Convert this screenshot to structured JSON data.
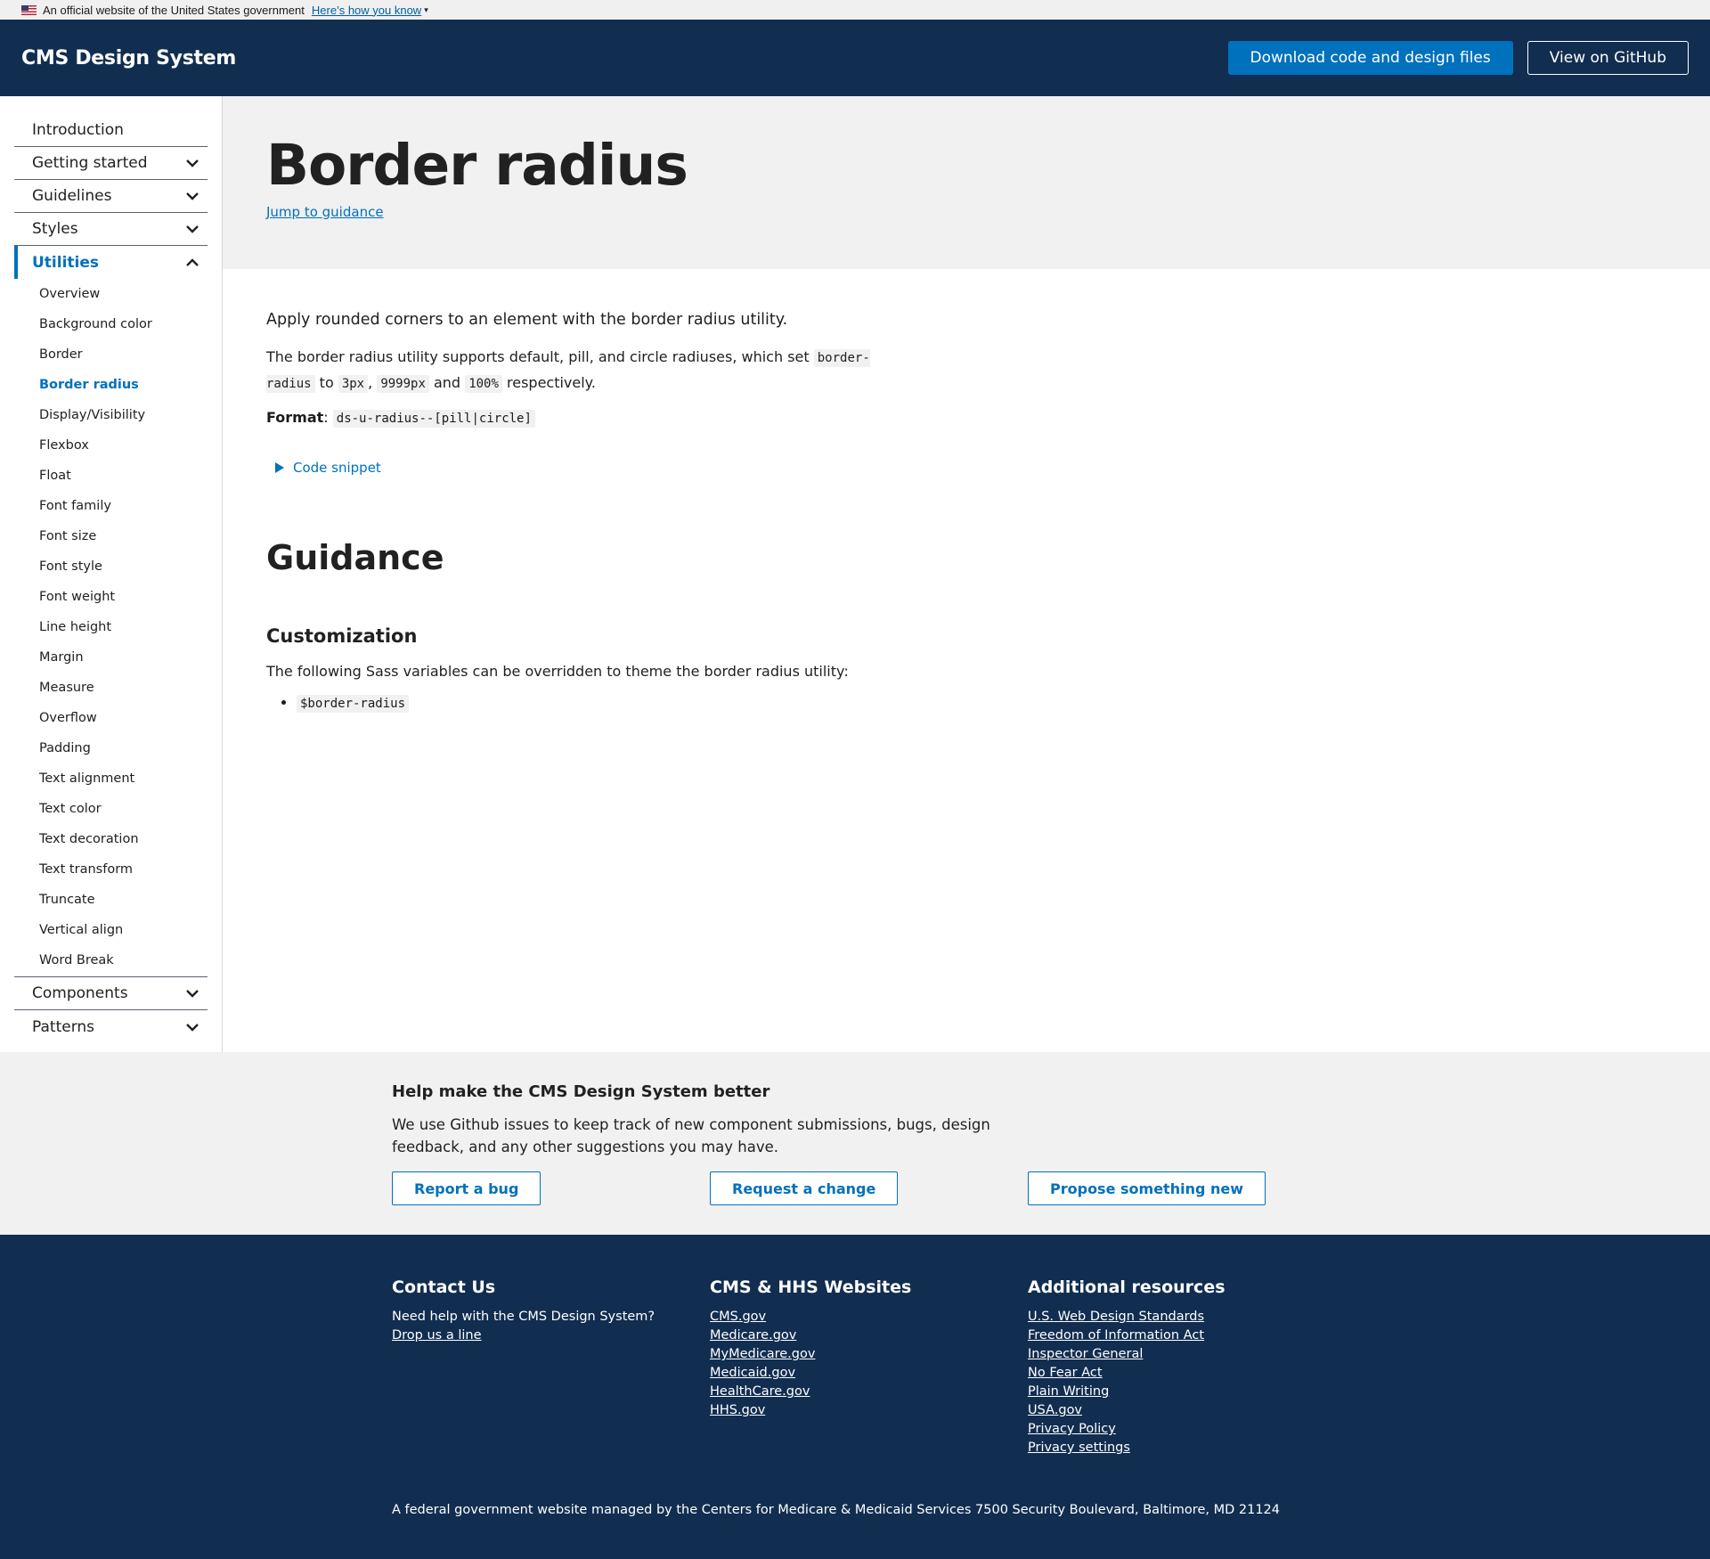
{
  "gov_banner": {
    "text": "An official website of the United States government",
    "link": "Here’s how you know"
  },
  "header": {
    "logo": "CMS Design System",
    "download_label": "Download code and design files",
    "github_label": "View on GitHub"
  },
  "sidebar": {
    "top_items": [
      {
        "label": "Introduction"
      },
      {
        "label": "Getting started"
      },
      {
        "label": "Guidelines"
      },
      {
        "label": "Styles"
      },
      {
        "label": "Utilities"
      },
      {
        "label": "Components"
      },
      {
        "label": "Patterns"
      }
    ],
    "utilities_items": [
      {
        "label": "Overview"
      },
      {
        "label": "Background color"
      },
      {
        "label": "Border"
      },
      {
        "label": "Border radius"
      },
      {
        "label": "Display/Visibility"
      },
      {
        "label": "Flexbox"
      },
      {
        "label": "Float"
      },
      {
        "label": "Font family"
      },
      {
        "label": "Font size"
      },
      {
        "label": "Font style"
      },
      {
        "label": "Font weight"
      },
      {
        "label": "Line height"
      },
      {
        "label": "Margin"
      },
      {
        "label": "Measure"
      },
      {
        "label": "Overflow"
      },
      {
        "label": "Padding"
      },
      {
        "label": "Text alignment"
      },
      {
        "label": "Text color"
      },
      {
        "label": "Text decoration"
      },
      {
        "label": "Text transform"
      },
      {
        "label": "Truncate"
      },
      {
        "label": "Vertical align"
      },
      {
        "label": "Word Break"
      }
    ]
  },
  "page": {
    "title": "Border radius",
    "jump_link": "Jump to guidance",
    "lead": "Apply rounded corners to an element with the border radius utility.",
    "para_1": "The border radius utility supports default, pill, and circle radiuses, which set",
    "code_border_radius": "border-radius",
    "para_to": "to",
    "code_3px": "3px",
    "comma": ",",
    "code_9999px": "9999px",
    "para_and": "and",
    "code_100": "100%",
    "para_end": "respectively.",
    "format_label": "Format",
    "format_colon": ":",
    "format_code": "ds-u-radius--[pill|circle]",
    "snippet_label": "Code snippet",
    "guidance_heading": "Guidance",
    "customization_heading": "Customization",
    "customization_text": "The following Sass variables can be overridden to theme the border radius utility:",
    "sass_variable": "$border-radius"
  },
  "feedback": {
    "title": "Help make the CMS Design System better",
    "text": "We use Github issues to keep track of new component submissions, bugs, design feedback, and any other suggestions you may have.",
    "report_bug": "Report a bug",
    "request_change": "Request a change",
    "propose_new": "Propose something new"
  },
  "footer": {
    "contact_heading": "Contact Us",
    "contact_text": "Need help with the CMS Design System?",
    "contact_link": "Drop us a line",
    "sites_heading": "CMS & HHS Websites",
    "sites": [
      {
        "label": "CMS.gov"
      },
      {
        "label": "Medicare.gov"
      },
      {
        "label": "MyMedicare.gov"
      },
      {
        "label": "Medicaid.gov"
      },
      {
        "label": "HealthCare.gov"
      },
      {
        "label": "HHS.gov"
      }
    ],
    "resources_heading": "Additional resources",
    "resources": [
      {
        "label": "U.S. Web Design Standards"
      },
      {
        "label": "Freedom of Information Act"
      },
      {
        "label": "Inspector General"
      },
      {
        "label": "No Fear Act"
      },
      {
        "label": "Plain Writing"
      },
      {
        "label": "USA.gov"
      },
      {
        "label": "Privacy Policy"
      },
      {
        "label": "Privacy settings"
      }
    ],
    "note": "A federal government website managed by the Centers for Medicare & Medicaid Services 7500 Security Boulevard, Baltimore, MD 21124"
  },
  "colors": {
    "header_bg": "#112e51",
    "accent": "#0071bc",
    "light_bg": "#f1f1f1"
  }
}
